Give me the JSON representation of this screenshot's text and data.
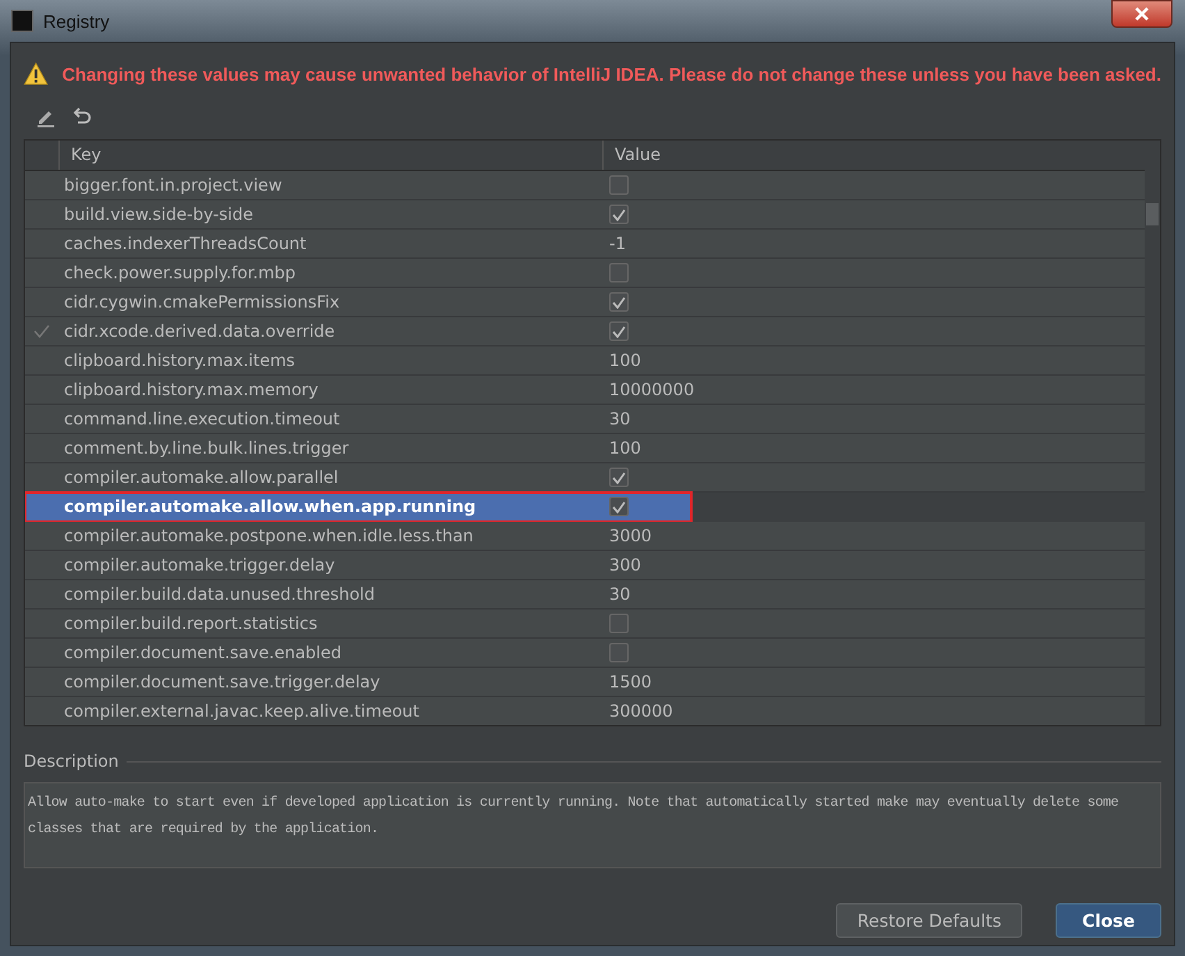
{
  "window": {
    "title": "Registry"
  },
  "warning": "Changing these values may cause unwanted behavior of IntelliJ IDEA. Please do not change these unless you have been asked.",
  "table": {
    "columns": [
      "Key",
      "Value"
    ],
    "rows": [
      {
        "key": "bigger.font.in.project.view",
        "kind": "checkbox",
        "checked": false,
        "modified": false,
        "selected": false,
        "annotated": false
      },
      {
        "key": "build.view.side-by-side",
        "kind": "checkbox",
        "checked": true,
        "modified": false,
        "selected": false,
        "annotated": false
      },
      {
        "key": "caches.indexerThreadsCount",
        "kind": "text",
        "value": "-1",
        "modified": false,
        "selected": false,
        "annotated": false
      },
      {
        "key": "check.power.supply.for.mbp",
        "kind": "checkbox",
        "checked": false,
        "modified": false,
        "selected": false,
        "annotated": false
      },
      {
        "key": "cidr.cygwin.cmakePermissionsFix",
        "kind": "checkbox",
        "checked": true,
        "modified": false,
        "selected": false,
        "annotated": false
      },
      {
        "key": "cidr.xcode.derived.data.override",
        "kind": "checkbox",
        "checked": true,
        "modified": true,
        "selected": false,
        "annotated": false
      },
      {
        "key": "clipboard.history.max.items",
        "kind": "text",
        "value": "100",
        "modified": false,
        "selected": false,
        "annotated": false
      },
      {
        "key": "clipboard.history.max.memory",
        "kind": "text",
        "value": "10000000",
        "modified": false,
        "selected": false,
        "annotated": false
      },
      {
        "key": "command.line.execution.timeout",
        "kind": "text",
        "value": "30",
        "modified": false,
        "selected": false,
        "annotated": false
      },
      {
        "key": "comment.by.line.bulk.lines.trigger",
        "kind": "text",
        "value": "100",
        "modified": false,
        "selected": false,
        "annotated": false
      },
      {
        "key": "compiler.automake.allow.parallel",
        "kind": "checkbox",
        "checked": true,
        "modified": false,
        "selected": false,
        "annotated": false
      },
      {
        "key": "compiler.automake.allow.when.app.running",
        "kind": "checkbox",
        "checked": true,
        "modified": false,
        "selected": true,
        "annotated": true
      },
      {
        "key": "compiler.automake.postpone.when.idle.less.than",
        "kind": "text",
        "value": "3000",
        "modified": false,
        "selected": false,
        "annotated": false
      },
      {
        "key": "compiler.automake.trigger.delay",
        "kind": "text",
        "value": "300",
        "modified": false,
        "selected": false,
        "annotated": false
      },
      {
        "key": "compiler.build.data.unused.threshold",
        "kind": "text",
        "value": "30",
        "modified": false,
        "selected": false,
        "annotated": false
      },
      {
        "key": "compiler.build.report.statistics",
        "kind": "checkbox",
        "checked": false,
        "modified": false,
        "selected": false,
        "annotated": false
      },
      {
        "key": "compiler.document.save.enabled",
        "kind": "checkbox",
        "checked": false,
        "modified": false,
        "selected": false,
        "annotated": false
      },
      {
        "key": "compiler.document.save.trigger.delay",
        "kind": "text",
        "value": "1500",
        "modified": false,
        "selected": false,
        "annotated": false
      },
      {
        "key": "compiler.external.javac.keep.alive.timeout",
        "kind": "text",
        "value": "300000",
        "modified": false,
        "selected": false,
        "annotated": false
      }
    ]
  },
  "description": {
    "label": "Description",
    "text": "Allow auto-make to start even if developed application is currently running. Note that automatically started make may eventually delete some classes that are required by the application."
  },
  "buttons": [
    {
      "label": "Restore Defaults",
      "default": false
    },
    {
      "label": "Close",
      "default": true
    }
  ]
}
